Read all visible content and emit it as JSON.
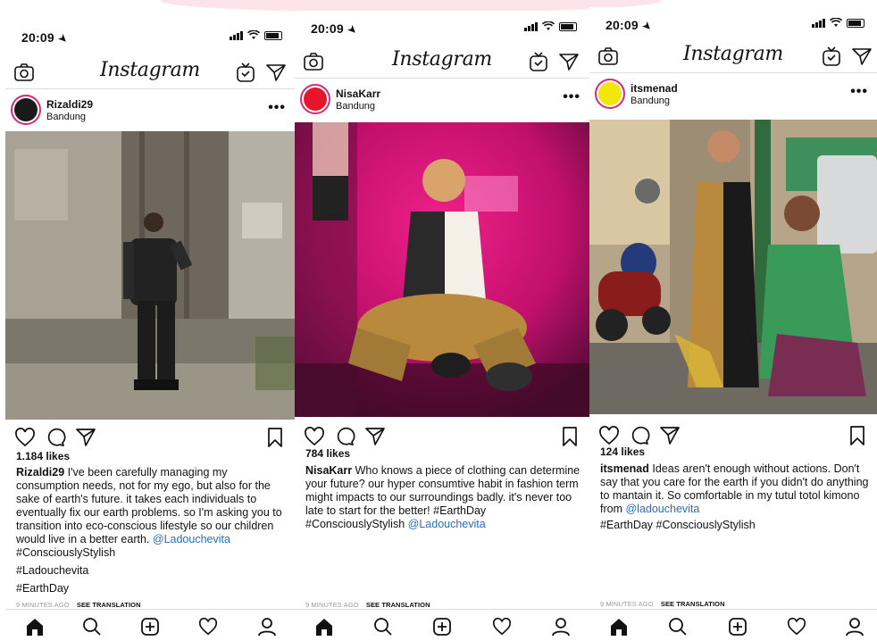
{
  "screens": [
    {
      "status_time": "20:09",
      "app_title": "Instagram",
      "username": "Rizaldi29",
      "location": "Bandung",
      "avatar_color": "#1a1a1a",
      "likes": "1.184 likes",
      "caption_user": "Rizaldi29",
      "caption_text": "I've been carefully managing my consumption needs, not for my ego, but also for the sake of earth's future. it takes each individuals to eventually fix our earth problems. so I'm asking you to transition into eco-conscious lifestyle so our children would live in a better earth.",
      "mention": "@Ladouchevita",
      "tags": [
        "#ConsciouslyStylish",
        "#Ladouchevita",
        "#EarthDay"
      ],
      "time_ago": "9 MINUTES AGO",
      "see_translation": "SEE TRANSLATION"
    },
    {
      "status_time": "20:09",
      "app_title": "Instagram",
      "username": "NisaKarr",
      "location": "Bandung",
      "avatar_color": "#e8142a",
      "likes": "784 likes",
      "caption_user": "NisaKarr",
      "caption_text": "Who knows a piece of clothing can determine your future? our hyper consumtive habit in fashion term might impacts to our surroundings badly. it's never too late to start for the better! #EarthDay #ConsciouslyStylish",
      "mention": "@Ladouchevita",
      "tags": [],
      "time_ago": "9 MINUTES AGO",
      "see_translation": "SEE TRANSLATION"
    },
    {
      "status_time": "20:09",
      "app_title": "Instagram",
      "username": "itsmenad",
      "location": "Bandung",
      "avatar_color": "#f5e60a",
      "likes": "124 likes",
      "caption_user": "itsmenad",
      "caption_text": "Ideas aren't enough without actions. Don't say that you care for the earth if you didn't do anything to mantain it. So comfortable in my tutul totol kimono from",
      "mention": "@ladouchevita",
      "tags": [
        "#EarthDay #ConsciouslyStylish"
      ],
      "time_ago": "9 MINUTES AGO",
      "see_translation": "SEE TRANSLATION"
    }
  ],
  "colors": {
    "mention": "#2b6fb5",
    "avatar_ring": "#d62976",
    "accent_pink": "#fde3ea"
  },
  "icons": [
    "camera-icon",
    "igtv-icon",
    "direct-icon",
    "more-icon",
    "heart-icon",
    "comment-icon",
    "share-icon",
    "bookmark-icon",
    "home-icon",
    "search-icon",
    "add-icon",
    "activity-icon",
    "profile-icon"
  ]
}
